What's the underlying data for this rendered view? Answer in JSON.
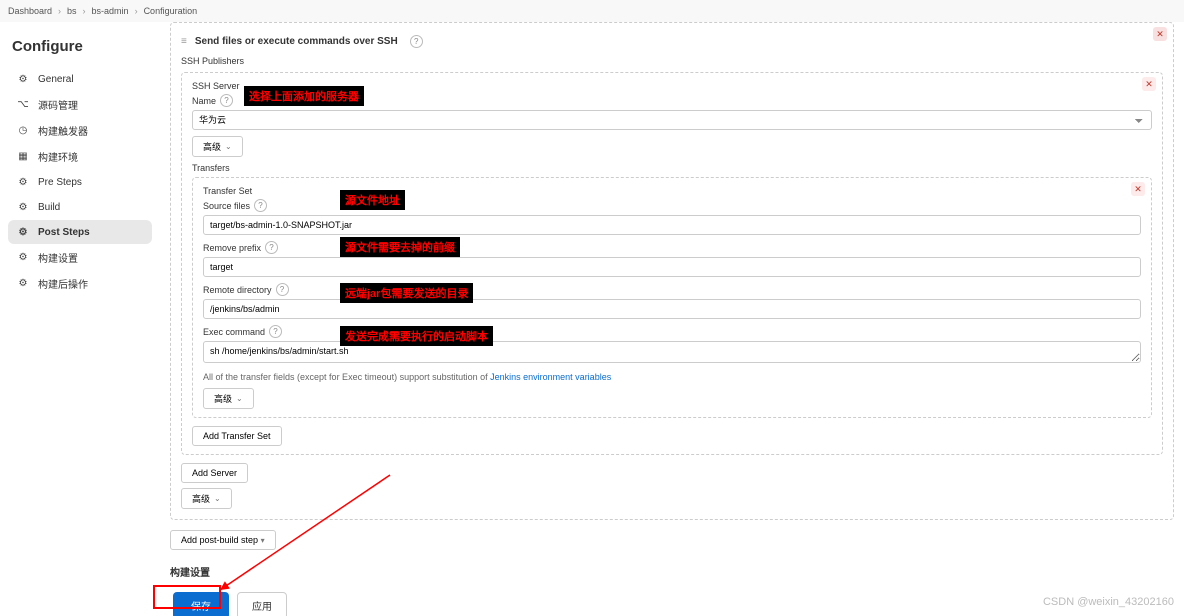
{
  "breadcrumb": [
    "Dashboard",
    "bs",
    "bs-admin",
    "Configuration"
  ],
  "configure_title": "Configure",
  "sidebar": [
    {
      "icon": "gear",
      "label": "General"
    },
    {
      "icon": "branch",
      "label": "源码管理"
    },
    {
      "icon": "clock",
      "label": "构建触发器"
    },
    {
      "icon": "grid",
      "label": "构建环境"
    },
    {
      "icon": "gear",
      "label": "Pre Steps"
    },
    {
      "icon": "gear",
      "label": "Build"
    },
    {
      "icon": "gear",
      "label": "Post Steps"
    },
    {
      "icon": "gear",
      "label": "构建设置"
    },
    {
      "icon": "gear",
      "label": "构建后操作"
    }
  ],
  "ssh_section": {
    "title": "Send files or execute commands over SSH",
    "publishers_label": "SSH Publishers",
    "server_heading": "SSH Server",
    "name_label": "Name",
    "server_value": "华为云",
    "adv_label": "高级",
    "transfers_label": "Transfers",
    "transfer_set_label": "Transfer Set",
    "source_files_label": "Source files",
    "source_files_value": "target/bs-admin-1.0-SNAPSHOT.jar",
    "remove_prefix_label": "Remove prefix",
    "remove_prefix_value": "target",
    "remote_dir_label": "Remote directory",
    "remote_dir_value": "/jenkins/bs/admin",
    "exec_cmd_label": "Exec command",
    "exec_cmd_value": "sh /home/jenkins/bs/admin/start.sh",
    "substitution_note_prefix": "All of the transfer fields (except for Exec timeout) support substitution of ",
    "substitution_link": "Jenkins environment variables",
    "add_transfer_set": "Add Transfer Set",
    "add_server": "Add Server"
  },
  "add_post_build": "Add post-build step",
  "build_settings_heading": "构建设置",
  "save_btn": "保存",
  "apply_btn": "应用",
  "overlays": {
    "o1": "选择上面添加的服务器",
    "o2": "源文件地址",
    "o3": "源文件需要去掉的前缀",
    "o4": "远端jar包需要发送的目录",
    "o5": "发送完成需要执行的启动脚本"
  },
  "watermark": "CSDN @weixin_43202160"
}
